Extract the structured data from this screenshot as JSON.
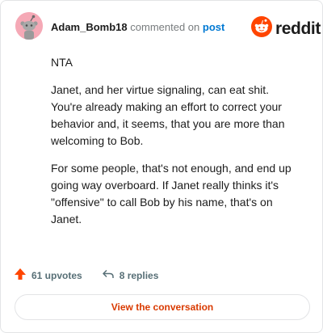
{
  "header": {
    "username": "Adam_Bomb18",
    "commented_text": "commented on",
    "post_link": "post"
  },
  "brand": {
    "wordmark": "reddit",
    "icon": "reddit-logo-icon",
    "color": "#ff4500"
  },
  "avatar": {
    "icon": "snoo-avatar-icon",
    "color": "#f5a9b6"
  },
  "comment": {
    "paragraphs": [
      "NTA",
      "Janet, and her virtue signaling, can eat shit. You're already making an effort to correct your behavior and, it seems, that you are more than welcoming to Bob.",
      "For some people, that's not enough, and end up going way overboard. If Janet really thinks it's \"offensive\" to call Bob by his name, that's on Janet."
    ]
  },
  "stats": {
    "upvotes": "61 upvotes",
    "upvote_icon": "upvote-arrow-icon",
    "replies": "8 replies",
    "reply_icon": "reply-arrow-icon"
  },
  "cta": {
    "label": "View the conversation",
    "color": "#d93a00"
  }
}
